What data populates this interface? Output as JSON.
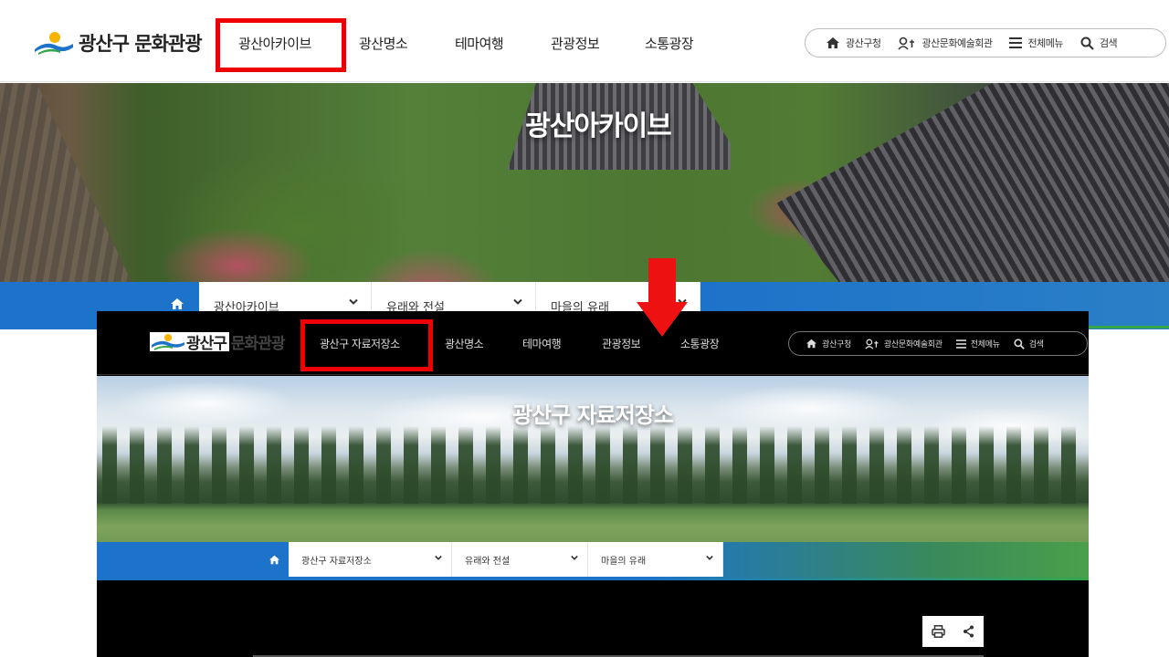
{
  "top": {
    "logo_text": "광산구 문화관광",
    "nav": [
      "광산아카이브",
      "광산명소",
      "테마여행",
      "관광정보",
      "소통광장"
    ],
    "util": {
      "office": "광산구청",
      "arts_center": "광산문화예술회관",
      "all_menu": "전체메뉴",
      "search": "검색"
    },
    "hero_title": "광산아카이브",
    "breadcrumb": [
      "광산아카이브",
      "유래와 전설",
      "마을의 유래"
    ]
  },
  "bottom": {
    "logo_a": "광산구",
    "logo_b": "문화관광",
    "nav": [
      "광산구 자료저장소",
      "광산명소",
      "테마여행",
      "관광정보",
      "소통광장"
    ],
    "util": {
      "office": "광산구청",
      "arts_center": "광산문화예술회관",
      "all_menu": "전체메뉴",
      "search": "검색"
    },
    "hero_title": "광산구 자료저장소",
    "breadcrumb": [
      "광산구 자료저장소",
      "유래와 전설",
      "마을의 유래"
    ]
  },
  "colors": {
    "highlight": "#ee0000",
    "brand_blue": "#1d73c9",
    "brand_green": "#35a64a"
  },
  "icons": [
    "home-icon",
    "person-icon",
    "hamburger-icon",
    "search-icon",
    "chevron-down-icon",
    "print-icon",
    "share-icon"
  ]
}
